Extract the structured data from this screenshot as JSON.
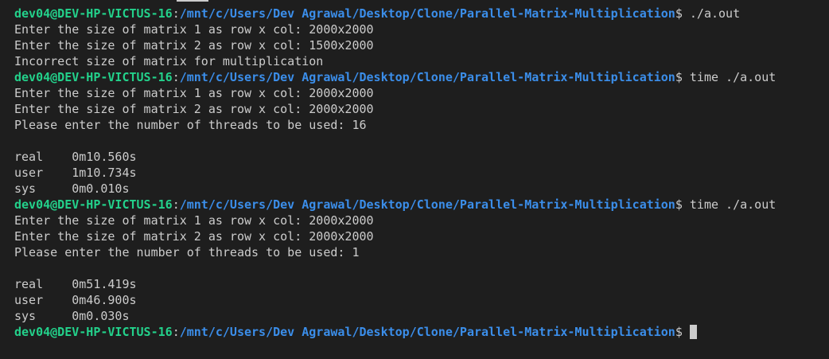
{
  "prompt": {
    "user_host": "dev04@DEV-HP-VICTUS-16",
    "colon": ":",
    "path": "/mnt/c/Users/Dev Agrawal/Desktop/Clone/Parallel-Matrix-Multiplication",
    "symbol": "$"
  },
  "lines": [
    {
      "type": "prompt",
      "command": " ./a.out"
    },
    {
      "type": "output",
      "text": "Enter the size of matrix 1 as row x col: 2000x2000"
    },
    {
      "type": "output",
      "text": "Enter the size of matrix 2 as row x col: 1500x2000"
    },
    {
      "type": "output",
      "text": "Incorrect size of matrix for multiplication"
    },
    {
      "type": "prompt",
      "command": " time ./a.out"
    },
    {
      "type": "output",
      "text": "Enter the size of matrix 1 as row x col: 2000x2000"
    },
    {
      "type": "output",
      "text": "Enter the size of matrix 2 as row x col: 2000x2000"
    },
    {
      "type": "output",
      "text": "Please enter the number of threads to be used: 16"
    },
    {
      "type": "output",
      "text": ""
    },
    {
      "type": "output",
      "text": "real    0m10.560s"
    },
    {
      "type": "output",
      "text": "user    1m10.734s"
    },
    {
      "type": "output",
      "text": "sys     0m0.010s"
    },
    {
      "type": "prompt",
      "command": " time ./a.out"
    },
    {
      "type": "output",
      "text": "Enter the size of matrix 1 as row x col: 2000x2000"
    },
    {
      "type": "output",
      "text": "Enter the size of matrix 2 as row x col: 2000x2000"
    },
    {
      "type": "output",
      "text": "Please enter the number of threads to be used: 1"
    },
    {
      "type": "output",
      "text": ""
    },
    {
      "type": "output",
      "text": "real    0m51.419s"
    },
    {
      "type": "output",
      "text": "user    0m46.900s"
    },
    {
      "type": "output",
      "text": "sys     0m0.030s"
    },
    {
      "type": "prompt",
      "command": " ",
      "cursor": true
    }
  ],
  "colors": {
    "background": "#1e1e1e",
    "foreground": "#cccccc",
    "user_host": "#23d18b",
    "path": "#3b8eea"
  }
}
